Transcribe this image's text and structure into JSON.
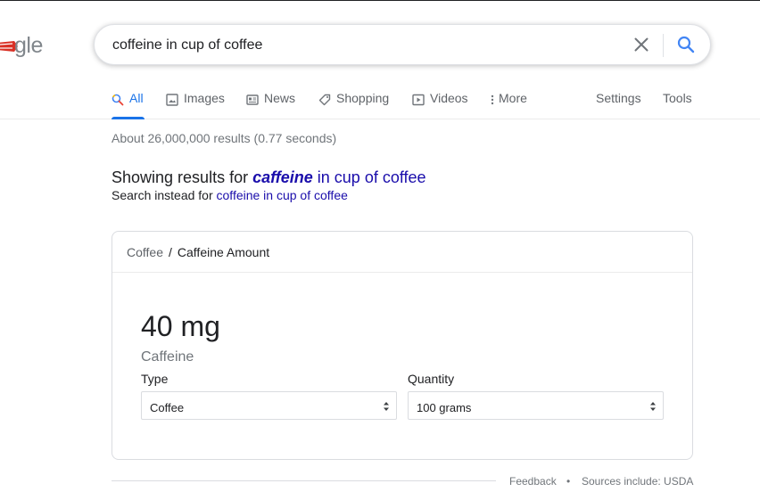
{
  "logo": {
    "text": "gle"
  },
  "search": {
    "query": "coffeine in cup of coffee",
    "clear_icon": "close-icon",
    "search_icon": "search-icon"
  },
  "nav": {
    "tabs": [
      {
        "label": "All",
        "icon": "search-icon",
        "active": true
      },
      {
        "label": "Images",
        "icon": "image-icon"
      },
      {
        "label": "News",
        "icon": "news-icon"
      },
      {
        "label": "Shopping",
        "icon": "tag-icon"
      },
      {
        "label": "Videos",
        "icon": "play-icon"
      },
      {
        "label": "More",
        "icon": "more-vertical-icon"
      }
    ],
    "settings": "Settings",
    "tools": "Tools"
  },
  "results": {
    "stats": "About 26,000,000 results (0.77 seconds)"
  },
  "spelling": {
    "showing_prefix": "Showing results for ",
    "corrected_word": "caffeine",
    "corrected_rest": " in cup of coffee",
    "instead_prefix": "Search instead for ",
    "original_query": "coffeine in cup of coffee"
  },
  "card": {
    "breadcrumb_parent": "Coffee",
    "breadcrumb_sep": "/",
    "breadcrumb_current": "Caffeine Amount",
    "amount": "40 mg",
    "amount_label": "Caffeine",
    "type_label": "Type",
    "type_value": "Coffee",
    "quantity_label": "Quantity",
    "quantity_value": "100 grams"
  },
  "footer": {
    "feedback": "Feedback",
    "separator": "•",
    "sources": "Sources include: USDA"
  },
  "colors": {
    "accent": "#1a73e8",
    "link": "#1a0dab",
    "muted": "#70757a"
  }
}
